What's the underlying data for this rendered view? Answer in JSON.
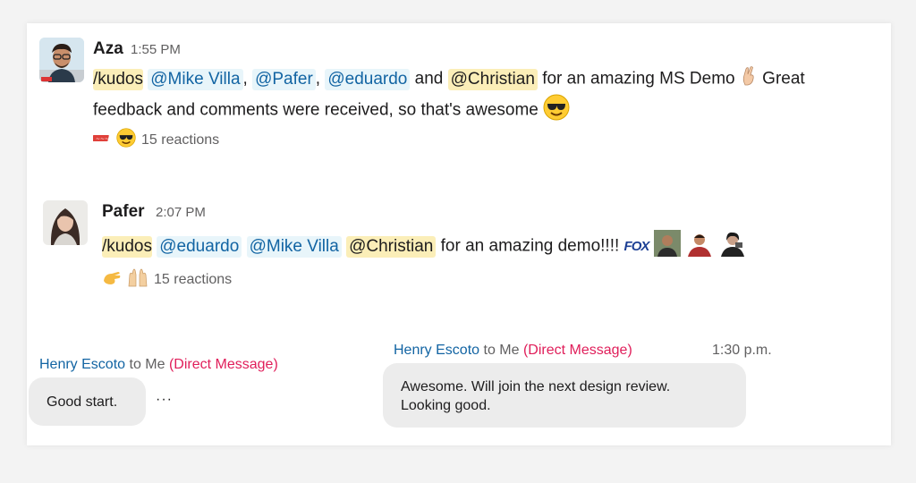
{
  "messages": [
    {
      "author": "Aza",
      "time": "1:55 PM",
      "line1": {
        "command": "/kudos",
        "mentions": [
          "@Mike Villa",
          "@Pafer",
          "@eduardo"
        ],
        "and_word": "and",
        "highlight_mention": "@Christian",
        "text_after": "for an amazing MS Demo",
        "text_end": "Great",
        "sep1": ",",
        "sep2": ","
      },
      "line2": "feedback and comments were received, so that's awesome",
      "reactions_label": "15 reactions",
      "emoji": [
        "crossed-fingers-icon",
        "sunglasses-emoji-icon"
      ]
    },
    {
      "author": "Pafer",
      "time": "2:07 PM",
      "line1": {
        "command": "/kudos",
        "mentions": [
          "@eduardo",
          "@Mike Villa"
        ],
        "highlight_mention": "@Christian",
        "text_after": "for an amazing demo!!!!",
        "fox_label": "FOX"
      },
      "reactions_label": "15 reactions"
    }
  ],
  "direct_messages": [
    {
      "from": "Henry Escoto",
      "to": "to Me",
      "kind": "(Direct Message)",
      "text": "Good start.",
      "more": "···"
    },
    {
      "from": "Henry Escoto",
      "to": "to Me",
      "kind": "(Direct Message)",
      "time": "1:30 p.m.",
      "text_line1": "Awesome. Will join the next design review.",
      "text_line2": "Looking good."
    }
  ],
  "colors": {
    "mention_bg": "#e8f5fa",
    "mention_text": "#1264a3",
    "highlight_bg": "#fbeeb8",
    "dm_red": "#e01e5a",
    "bubble_bg": "#ececec"
  }
}
